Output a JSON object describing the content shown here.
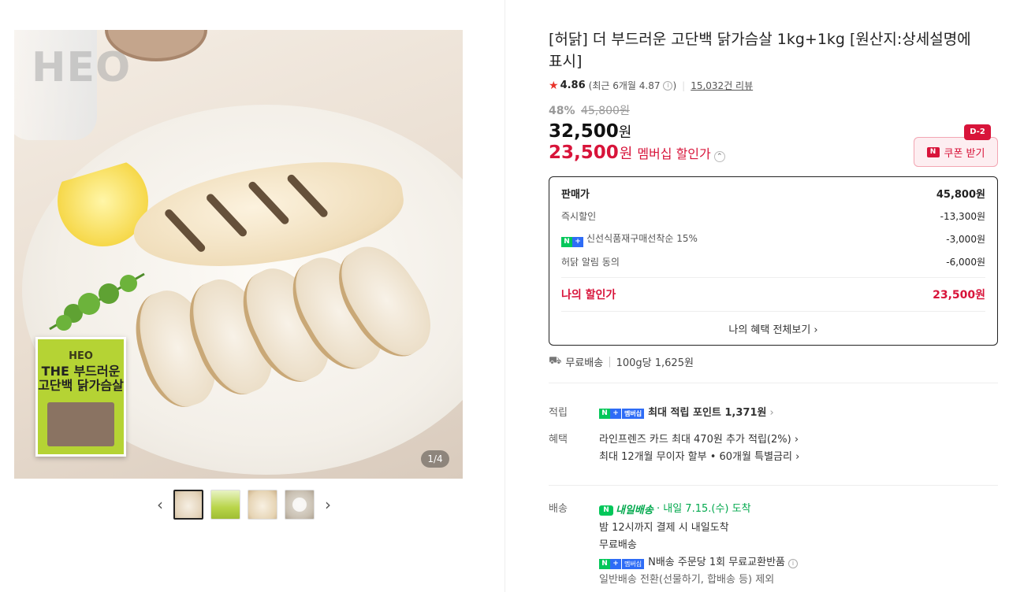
{
  "gallery": {
    "watermark": "HEO",
    "package_brand": "HEO",
    "package_title": "THE 부드러운 고단백 닭가슴살",
    "page_indicator": "1/4",
    "prev_arrow": "‹",
    "next_arrow": "›"
  },
  "product": {
    "title": "[허닭] 더 부드러운 고단백 닭가슴살 1kg+1kg [원산지:상세설명에 표시]",
    "rating": {
      "star": "★",
      "score": "4.86",
      "recent": "(최근 6개월 4.87",
      "recent_close": ")",
      "review_count": "15,032건 리뷰"
    },
    "discount_percent": "48%",
    "original_price": "45,800원",
    "sale_price": "32,500",
    "membership_price": "23,500",
    "currency": "원",
    "membership_label": "멤버십 할인가",
    "coupon": {
      "logo": "N",
      "label": "쿠폰 받기",
      "dday": "D-2"
    }
  },
  "price_box": {
    "rows": [
      {
        "label": "판매가",
        "amount": "45,800원"
      },
      {
        "label": "즉시할인",
        "amount": "-13,300원"
      },
      {
        "label": "신선식품재구매선착순 15%",
        "amount": "-3,000원"
      },
      {
        "label": "허닭 알림 동의",
        "amount": "-6,000원"
      }
    ],
    "total_label": "나의 할인가",
    "total_amount": "23,500원",
    "more_link": "나의 혜택 전체보기 ›"
  },
  "shipping": {
    "free": "무료배송",
    "unit_price": "100g당 1,625원"
  },
  "benefits": {
    "point_label": "적립",
    "point_text": "최대 적립 포인트 1,371원",
    "benefit_label": "혜택",
    "benefit_line1": "라인프렌즈 카드 최대 470원 추가 적립(2%) ›",
    "benefit_line2": "최대 12개월 무이자 할부 • 60개월 특별금리 ›",
    "membership_tag": "멤버십"
  },
  "delivery": {
    "label": "배송",
    "badge": "내일배송",
    "eta": "· 내일 7.15.(수) 도착",
    "line1": "밤 12시까지 결제 시 내일도착",
    "line2": "무료배송",
    "line3": "N배송 주문당 1회 무료교환반품",
    "line4": "일반배송 전환(선물하기, 합배송 등) 제외"
  },
  "colors": {
    "accent_red": "#d8143a",
    "naver_green": "#03c75a",
    "point_purple": "#6b39d6"
  }
}
